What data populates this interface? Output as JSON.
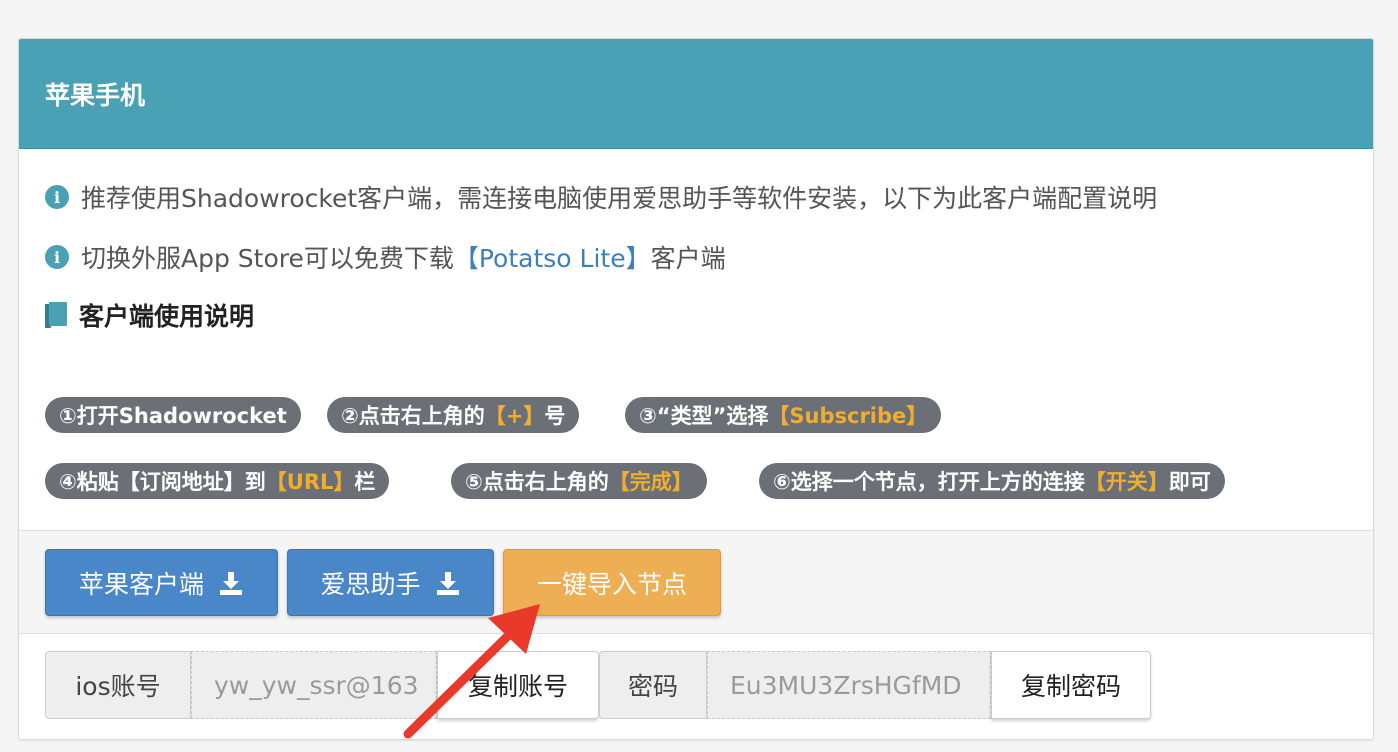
{
  "panel": {
    "title": "苹果手机"
  },
  "info": [
    {
      "text": "推荐使用Shadowrocket客户端，需连接电脑使用爱思助手等软件安装，以下为此客户端配置说明"
    },
    {
      "prefix": "切换外服App Store可以免费下载",
      "link": "【Potatso Lite】",
      "suffix": "客户端"
    }
  ],
  "guide_title": "客户端使用说明",
  "steps": [
    {
      "text": "①打开Shadowrocket",
      "hl": "",
      "tail": ""
    },
    {
      "text": "②点击右上角的",
      "hl": "【+】",
      "tail": "号"
    },
    {
      "text": "③“类型”选择",
      "hl": "【Subscribe】",
      "tail": ""
    },
    {
      "text": "④粘贴【订阅地址】到",
      "hl": "【URL】",
      "tail": "栏"
    },
    {
      "text": "⑤点击右上角的",
      "hl": "【完成】",
      "tail": ""
    },
    {
      "text": "⑥选择一个节点，打开上方的连接",
      "hl": "【开关】",
      "tail": "即可"
    }
  ],
  "buttons": {
    "apple_client": "苹果客户端",
    "aisi": "爱思助手",
    "import_nodes": "一键导入节点"
  },
  "account": {
    "ios_label": "ios账号",
    "ios_value": "yw_yw_ssr@163",
    "copy_account": "复制账号",
    "password_label": "密码",
    "password_value": "Eu3MU3ZrsHGfMD",
    "copy_password": "复制密码"
  },
  "colors": {
    "header": "#4aa0b4",
    "primary": "#4a87c8",
    "warning": "#eeae54",
    "step_bg": "#6b6f76",
    "highlight": "#f0ad2e",
    "arrow": "#e8392b"
  },
  "icons": [
    "info-icon",
    "book-icon",
    "download-icon",
    "annotation-arrow"
  ]
}
